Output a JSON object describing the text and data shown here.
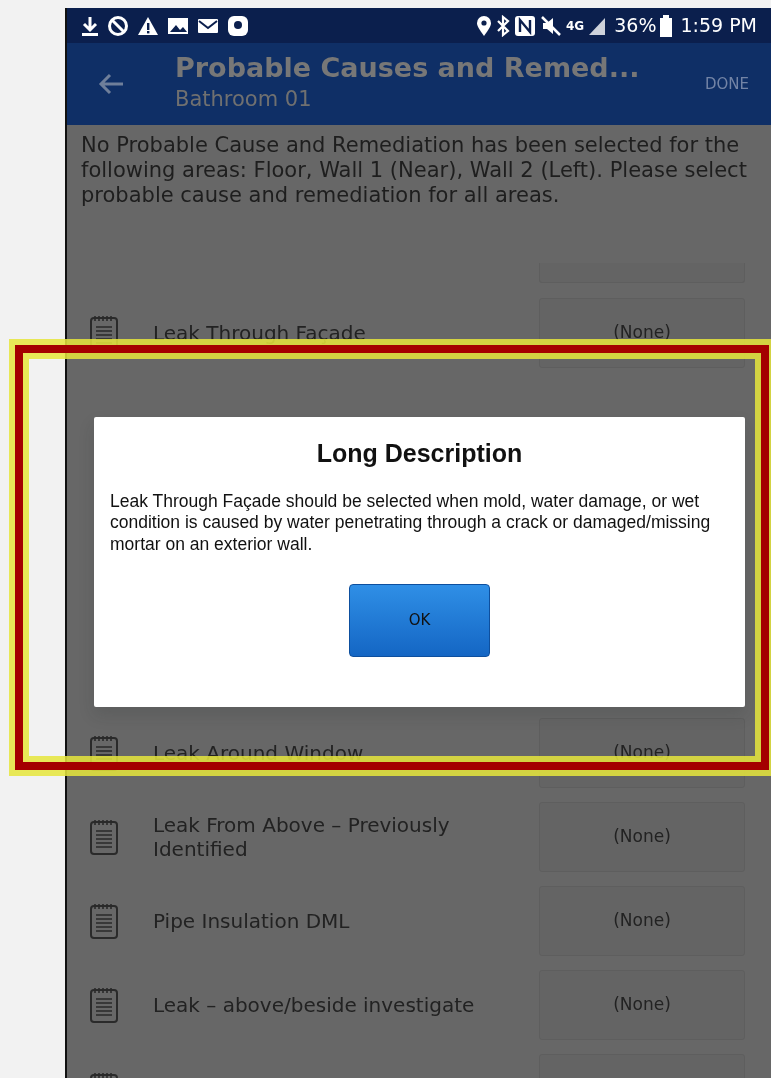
{
  "status_bar": {
    "network": "4G",
    "battery": "36%",
    "time": "1:59 PM"
  },
  "app_bar": {
    "title": "Probable Causes and Remed...",
    "subtitle": "Bathroom 01",
    "action": "DONE"
  },
  "message": "No Probable Cause and Remediation has been selected for the following areas: Floor, Wall 1 (Near), Wall 2 (Left). Please select probable cause and remediation for all areas.",
  "rows": [
    {
      "kind": "item",
      "label": "Leak Through Façade",
      "value": "(None)"
    },
    {
      "kind": "hidden"
    },
    {
      "kind": "hidden"
    },
    {
      "kind": "hidden"
    },
    {
      "kind": "hidden"
    },
    {
      "kind": "item",
      "label": "Leak Around Window",
      "value": "(None)"
    },
    {
      "kind": "item",
      "label": "Leak From Above – Previously Identified",
      "value": "(None)"
    },
    {
      "kind": "item",
      "label": "Pipe Insulation DML",
      "value": "(None)"
    },
    {
      "kind": "item",
      "label": "Leak – above/beside investigate",
      "value": "(None)"
    },
    {
      "kind": "cut"
    }
  ],
  "dialog": {
    "title": "Long Description",
    "body": "Leak Through Façade should be selected when mold, water damage, or wet condition is caused by water penetrating through a crack or damaged/missing mortar on an exterior wall.",
    "button": "OK"
  },
  "annotation": {
    "highlight": true
  }
}
